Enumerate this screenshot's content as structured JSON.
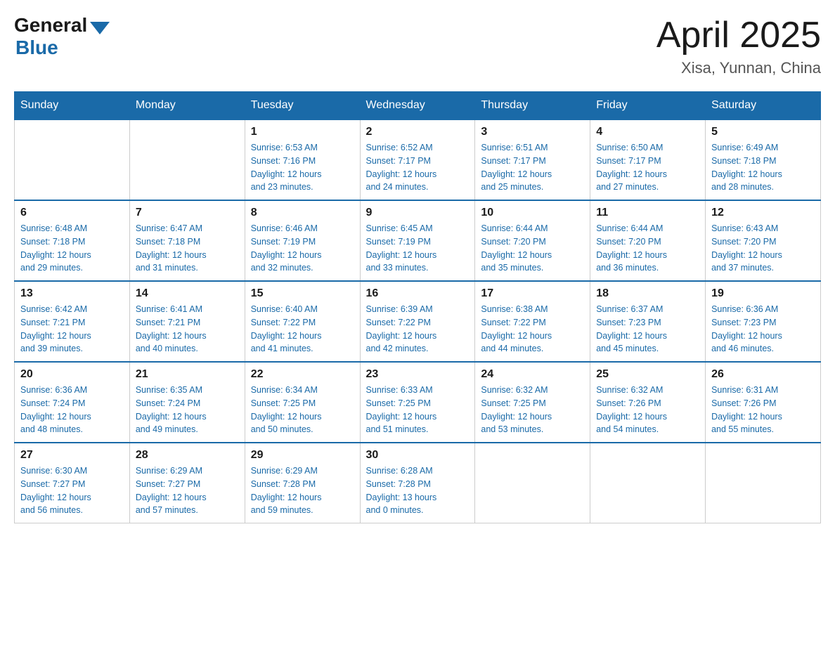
{
  "logo": {
    "general": "General",
    "blue": "Blue"
  },
  "title": "April 2025",
  "subtitle": "Xisa, Yunnan, China",
  "days_of_week": [
    "Sunday",
    "Monday",
    "Tuesday",
    "Wednesday",
    "Thursday",
    "Friday",
    "Saturday"
  ],
  "weeks": [
    [
      {
        "day": "",
        "info": ""
      },
      {
        "day": "",
        "info": ""
      },
      {
        "day": "1",
        "info": "Sunrise: 6:53 AM\nSunset: 7:16 PM\nDaylight: 12 hours\nand 23 minutes."
      },
      {
        "day": "2",
        "info": "Sunrise: 6:52 AM\nSunset: 7:17 PM\nDaylight: 12 hours\nand 24 minutes."
      },
      {
        "day": "3",
        "info": "Sunrise: 6:51 AM\nSunset: 7:17 PM\nDaylight: 12 hours\nand 25 minutes."
      },
      {
        "day": "4",
        "info": "Sunrise: 6:50 AM\nSunset: 7:17 PM\nDaylight: 12 hours\nand 27 minutes."
      },
      {
        "day": "5",
        "info": "Sunrise: 6:49 AM\nSunset: 7:18 PM\nDaylight: 12 hours\nand 28 minutes."
      }
    ],
    [
      {
        "day": "6",
        "info": "Sunrise: 6:48 AM\nSunset: 7:18 PM\nDaylight: 12 hours\nand 29 minutes."
      },
      {
        "day": "7",
        "info": "Sunrise: 6:47 AM\nSunset: 7:18 PM\nDaylight: 12 hours\nand 31 minutes."
      },
      {
        "day": "8",
        "info": "Sunrise: 6:46 AM\nSunset: 7:19 PM\nDaylight: 12 hours\nand 32 minutes."
      },
      {
        "day": "9",
        "info": "Sunrise: 6:45 AM\nSunset: 7:19 PM\nDaylight: 12 hours\nand 33 minutes."
      },
      {
        "day": "10",
        "info": "Sunrise: 6:44 AM\nSunset: 7:20 PM\nDaylight: 12 hours\nand 35 minutes."
      },
      {
        "day": "11",
        "info": "Sunrise: 6:44 AM\nSunset: 7:20 PM\nDaylight: 12 hours\nand 36 minutes."
      },
      {
        "day": "12",
        "info": "Sunrise: 6:43 AM\nSunset: 7:20 PM\nDaylight: 12 hours\nand 37 minutes."
      }
    ],
    [
      {
        "day": "13",
        "info": "Sunrise: 6:42 AM\nSunset: 7:21 PM\nDaylight: 12 hours\nand 39 minutes."
      },
      {
        "day": "14",
        "info": "Sunrise: 6:41 AM\nSunset: 7:21 PM\nDaylight: 12 hours\nand 40 minutes."
      },
      {
        "day": "15",
        "info": "Sunrise: 6:40 AM\nSunset: 7:22 PM\nDaylight: 12 hours\nand 41 minutes."
      },
      {
        "day": "16",
        "info": "Sunrise: 6:39 AM\nSunset: 7:22 PM\nDaylight: 12 hours\nand 42 minutes."
      },
      {
        "day": "17",
        "info": "Sunrise: 6:38 AM\nSunset: 7:22 PM\nDaylight: 12 hours\nand 44 minutes."
      },
      {
        "day": "18",
        "info": "Sunrise: 6:37 AM\nSunset: 7:23 PM\nDaylight: 12 hours\nand 45 minutes."
      },
      {
        "day": "19",
        "info": "Sunrise: 6:36 AM\nSunset: 7:23 PM\nDaylight: 12 hours\nand 46 minutes."
      }
    ],
    [
      {
        "day": "20",
        "info": "Sunrise: 6:36 AM\nSunset: 7:24 PM\nDaylight: 12 hours\nand 48 minutes."
      },
      {
        "day": "21",
        "info": "Sunrise: 6:35 AM\nSunset: 7:24 PM\nDaylight: 12 hours\nand 49 minutes."
      },
      {
        "day": "22",
        "info": "Sunrise: 6:34 AM\nSunset: 7:25 PM\nDaylight: 12 hours\nand 50 minutes."
      },
      {
        "day": "23",
        "info": "Sunrise: 6:33 AM\nSunset: 7:25 PM\nDaylight: 12 hours\nand 51 minutes."
      },
      {
        "day": "24",
        "info": "Sunrise: 6:32 AM\nSunset: 7:25 PM\nDaylight: 12 hours\nand 53 minutes."
      },
      {
        "day": "25",
        "info": "Sunrise: 6:32 AM\nSunset: 7:26 PM\nDaylight: 12 hours\nand 54 minutes."
      },
      {
        "day": "26",
        "info": "Sunrise: 6:31 AM\nSunset: 7:26 PM\nDaylight: 12 hours\nand 55 minutes."
      }
    ],
    [
      {
        "day": "27",
        "info": "Sunrise: 6:30 AM\nSunset: 7:27 PM\nDaylight: 12 hours\nand 56 minutes."
      },
      {
        "day": "28",
        "info": "Sunrise: 6:29 AM\nSunset: 7:27 PM\nDaylight: 12 hours\nand 57 minutes."
      },
      {
        "day": "29",
        "info": "Sunrise: 6:29 AM\nSunset: 7:28 PM\nDaylight: 12 hours\nand 59 minutes."
      },
      {
        "day": "30",
        "info": "Sunrise: 6:28 AM\nSunset: 7:28 PM\nDaylight: 13 hours\nand 0 minutes."
      },
      {
        "day": "",
        "info": ""
      },
      {
        "day": "",
        "info": ""
      },
      {
        "day": "",
        "info": ""
      }
    ]
  ]
}
